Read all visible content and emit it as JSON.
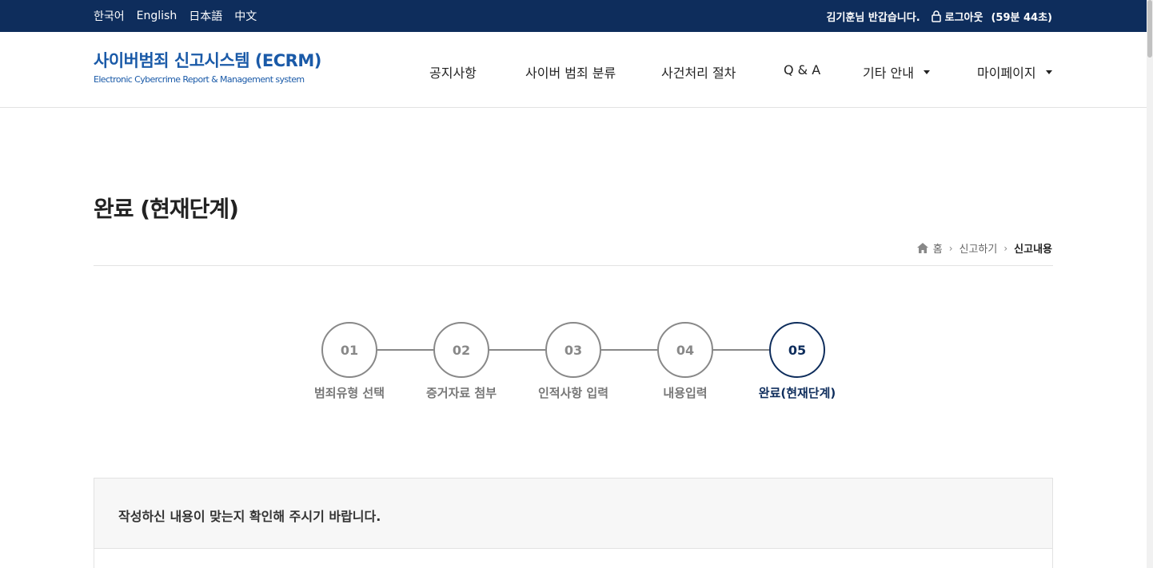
{
  "topbar": {
    "languages": [
      "한국어",
      "English",
      "日本語",
      "中文"
    ],
    "greeting": "김기훈님 반갑습니다.",
    "logout_label": "로그아웃",
    "session_timer": "(59분 44초)"
  },
  "header": {
    "logo_title": "사이버범죄 신고시스템 (ECRM)",
    "logo_subtitle": "Electronic Cybercrime Report & Management system",
    "nav": [
      "공지사항",
      "사이버 범죄 분류",
      "사건처리 절차",
      "Q & A",
      "기타 안내",
      "마이페이지"
    ]
  },
  "page": {
    "title": "완료 (현재단계)",
    "breadcrumb": [
      "홈",
      "신고하기",
      "신고내용"
    ]
  },
  "steps": [
    {
      "number": "01",
      "label": "범죄유형 선택",
      "active": false
    },
    {
      "number": "02",
      "label": "증거자료 첨부",
      "active": false
    },
    {
      "number": "03",
      "label": "인적사항 입력",
      "active": false
    },
    {
      "number": "04",
      "label": "내용입력",
      "active": false
    },
    {
      "number": "05",
      "label": "완료(현재단계)",
      "active": true
    }
  ],
  "notice": {
    "text": "작성하신 내용이 맞는지 확인해 주시기 바랍니다."
  },
  "colors": {
    "topbar_bg": "#0e2d5c",
    "brand_blue": "#1a5aa8",
    "active_step": "#0e2d5c",
    "inactive_step": "#888888"
  }
}
